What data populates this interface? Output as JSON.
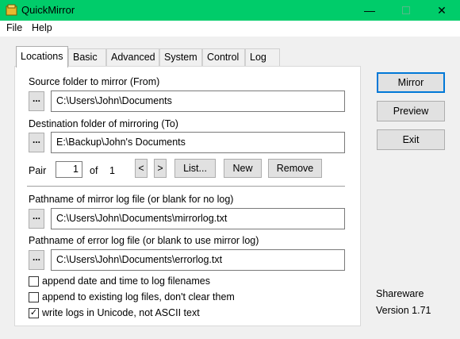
{
  "window": {
    "title": "QuickMirror"
  },
  "menu": [
    "File",
    "Help"
  ],
  "tabs": [
    "Locations",
    "Basic",
    "Advanced",
    "System",
    "Control",
    "Log"
  ],
  "locations": {
    "source_label": "Source folder to mirror (From)",
    "source_value": "C:\\Users\\John\\Documents",
    "dest_label": "Destination folder of mirroring (To)",
    "dest_value": "E:\\Backup\\John's Documents",
    "browse_label": "...",
    "pair_label": "Pair",
    "pair_value": "1",
    "of_label": "of",
    "pair_total": "1",
    "prev_label": "<",
    "next_label": ">",
    "list_label": "List...",
    "new_label": "New",
    "remove_label": "Remove",
    "mirror_log_label": "Pathname of mirror log file (or blank for no log)",
    "mirror_log_value": "C:\\Users\\John\\Documents\\mirrorlog.txt",
    "error_log_label": "Pathname of error log file (or blank to use mirror log)",
    "error_log_value": "C:\\Users\\John\\Documents\\errorlog.txt",
    "checkboxes": [
      {
        "label": "append date and time to log filenames",
        "checked": false
      },
      {
        "label": "append to existing log files, don't clear them",
        "checked": false
      },
      {
        "label": "write logs in Unicode, not ASCII text",
        "checked": true
      }
    ]
  },
  "actions": {
    "mirror": "Mirror",
    "preview": "Preview",
    "exit": "Exit"
  },
  "info": {
    "edition": "Shareware",
    "version": "Version 1.71"
  },
  "colors": {
    "titlebar": "#00cc6a",
    "focus_border": "#0078d7"
  }
}
